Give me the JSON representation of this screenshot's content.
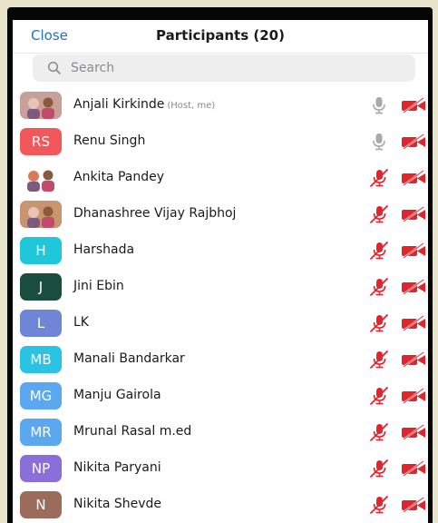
{
  "header": {
    "close_label": "Close",
    "title": "Participants (20)"
  },
  "search": {
    "placeholder": "Search"
  },
  "colors": {
    "accent": "#1f6fd6",
    "muted_red": "#e0262c",
    "mic_gray": "#a9a9a9"
  },
  "participants": [
    {
      "name": "Anjali Kirkinde",
      "role": "(Host, me)",
      "initials": "",
      "avatar": "photo-avatar",
      "avatar_color": "#c8a09a",
      "mic": "mic-icon",
      "video": "video-off-icon"
    },
    {
      "name": "Renu Singh",
      "role": "",
      "initials": "RS",
      "avatar": "initials",
      "avatar_color": "#f2575c",
      "mic": "mic-icon",
      "video": "video-off-icon"
    },
    {
      "name": "Ankita Pandey",
      "role": "",
      "initials": "",
      "avatar": "photo-avatar",
      "avatar_color": "#ffffff",
      "mic": "mic-muted-icon",
      "video": "video-off-icon"
    },
    {
      "name": "Dhanashree Vijay Rajbhoj",
      "role": "",
      "initials": "",
      "avatar": "photo-avatar",
      "avatar_color": "#c7956f",
      "mic": "mic-muted-icon",
      "video": "video-off-icon"
    },
    {
      "name": "Harshada",
      "role": "",
      "initials": "H",
      "avatar": "initials",
      "avatar_color": "#1fc8d9",
      "mic": "mic-muted-icon",
      "video": "video-off-icon"
    },
    {
      "name": "Jini Ebin",
      "role": "",
      "initials": "J",
      "avatar": "initials",
      "avatar_color": "#1b4d3e",
      "mic": "mic-muted-icon",
      "video": "video-off-icon"
    },
    {
      "name": "LK",
      "role": "",
      "initials": "L",
      "avatar": "initials",
      "avatar_color": "#6f86d6",
      "mic": "mic-muted-icon",
      "video": "video-off-icon"
    },
    {
      "name": "Manali Bandarkar",
      "role": "",
      "initials": "MB",
      "avatar": "initials",
      "avatar_color": "#2bc3e4",
      "mic": "mic-muted-icon",
      "video": "video-off-icon"
    },
    {
      "name": "Manju Gairola",
      "role": "",
      "initials": "MG",
      "avatar": "initials",
      "avatar_color": "#5ba8f0",
      "mic": "mic-muted-icon",
      "video": "video-off-icon"
    },
    {
      "name": "Mrunal Rasal m.ed",
      "role": "",
      "initials": "MR",
      "avatar": "initials",
      "avatar_color": "#5ba8f0",
      "mic": "mic-muted-icon",
      "video": "video-off-icon"
    },
    {
      "name": "Nikita Paryani",
      "role": "",
      "initials": "NP",
      "avatar": "initials",
      "avatar_color": "#8a6fd8",
      "mic": "mic-muted-icon",
      "video": "video-off-icon"
    },
    {
      "name": "Nikita Shevde",
      "role": "",
      "initials": "N",
      "avatar": "initials",
      "avatar_color": "#9b6b5b",
      "mic": "mic-muted-icon",
      "video": "video-off-icon"
    }
  ]
}
